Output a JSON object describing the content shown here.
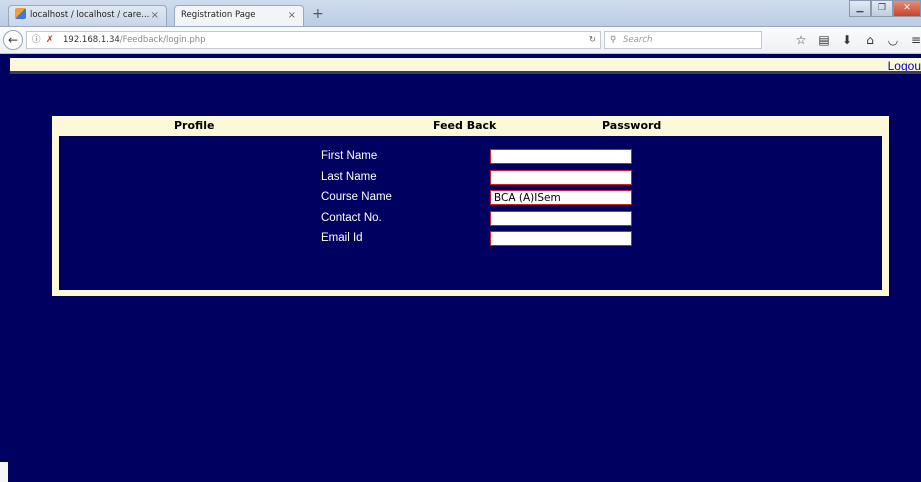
{
  "browser": {
    "tabs": [
      {
        "label": "localhost / localhost / care...",
        "active": false
      },
      {
        "label": "Registration Page",
        "active": true
      }
    ],
    "new_tab": "+",
    "address": {
      "host": "192.168.1.34",
      "path": "/Feedback/login.php"
    },
    "search_placeholder": "Search"
  },
  "page": {
    "logout_label": "Logou",
    "menu": [
      "Profile",
      "Feed Back",
      "Password"
    ],
    "form": {
      "fields": [
        {
          "label": "First Name",
          "value": ""
        },
        {
          "label": "Last Name",
          "value": ""
        },
        {
          "label": "Course Name",
          "value": "BCA (A)ISem"
        },
        {
          "label": "Contact No.",
          "value": ""
        },
        {
          "label": "Email Id",
          "value": ""
        }
      ]
    }
  },
  "colors": {
    "page_background": "#000060",
    "panel_background": "#fbf9da",
    "field_border": "#d01e28",
    "link": "#0000cc"
  }
}
